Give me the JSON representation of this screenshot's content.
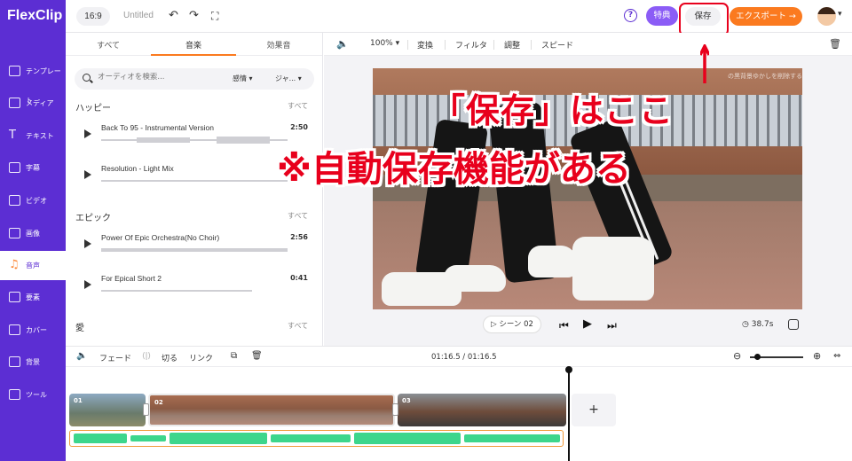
{
  "app": {
    "logo": "FlexClip",
    "aspect_ratio": "16:9",
    "project_title": "Untitled"
  },
  "header": {
    "tokuten_label": "特典",
    "save_label": "保存",
    "export_label": "エクスポート →",
    "help_glyph": "?"
  },
  "sidebar": {
    "items": [
      {
        "label": "テンプレート",
        "icon": "template-icon"
      },
      {
        "label": "メディア",
        "icon": "media-icon"
      },
      {
        "label": "テキスト",
        "icon": "text-icon"
      },
      {
        "label": "字幕",
        "icon": "subtitle-icon"
      },
      {
        "label": "ビデオ",
        "icon": "video-icon"
      },
      {
        "label": "画像",
        "icon": "image-icon"
      },
      {
        "label": "音声",
        "icon": "music-icon",
        "active": true
      },
      {
        "label": "要素",
        "icon": "element-icon"
      },
      {
        "label": "カバー",
        "icon": "cover-icon"
      },
      {
        "label": "背景",
        "icon": "background-icon"
      },
      {
        "label": "ツール",
        "icon": "tool-icon"
      }
    ]
  },
  "panel": {
    "tabs": [
      "すべて",
      "音楽",
      "効果音"
    ],
    "active_tab": "音楽",
    "search_placeholder": "オーディオを検索...",
    "filter1": "感情",
    "filter2": "ジャ...",
    "sections": [
      {
        "title": "ハッピー",
        "all": "すべて",
        "tracks": [
          {
            "title": "Back To 95 - Instrumental Version",
            "duration": "2:50"
          },
          {
            "title": "Resolution - Light Mix",
            "duration": ""
          }
        ]
      },
      {
        "title": "エピック",
        "all": "すべて",
        "tracks": [
          {
            "title": "Power Of Epic Orchestra(No Choir)",
            "duration": "2:56"
          },
          {
            "title": "For Epical Short 2",
            "duration": "0:41"
          }
        ]
      },
      {
        "title": "愛",
        "all": "すべて",
        "tracks": []
      }
    ]
  },
  "canvas_toolbar": {
    "zoom": "100%",
    "replace": "変換",
    "filter": "フィルタ",
    "adjust": "調整",
    "speed": "スピード"
  },
  "video": {
    "overlay_text": "の黒背景ゆかしを削除する"
  },
  "annotations": {
    "line1": "「保存」はここ",
    "line2": "※自動保存機能がある",
    "arrow": "↑"
  },
  "playback": {
    "scene_label": "シーン 02",
    "duration": "38.7s"
  },
  "timeline": {
    "fade": "フェード",
    "cut": "切る",
    "link": "リンク",
    "timecode": "01:16.5 / 01:16.5",
    "clips": [
      "01",
      "02",
      "03"
    ],
    "add": "+"
  },
  "colors": {
    "brand_purple": "#5c2ed3",
    "accent_orange": "#fb7a1f",
    "annotation_red": "#e8001c",
    "audio_green": "#3dd68c"
  }
}
